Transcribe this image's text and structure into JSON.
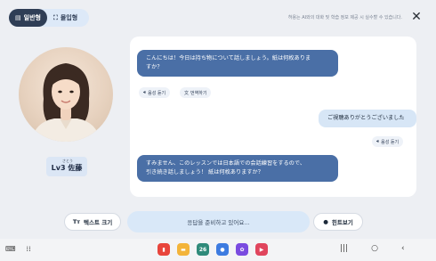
{
  "header": {
    "mode_tabs": [
      {
        "label": "일반형",
        "icon": "list-icon",
        "active": true
      },
      {
        "label": "몰입형",
        "icon": "fullscreen-icon",
        "active": false
      }
    ],
    "disclaimer": "허용는 AI와의 대화 및 학습 정보 제공 시 실수할 수 있습니다.",
    "close_icon": "close-icon"
  },
  "avatar": {
    "level_ruby": "さとう",
    "level_label": "Lv3 佐藤"
  },
  "chat": {
    "messages": [
      {
        "role": "ai",
        "lines": [
          "こんにちは！今日は持ち物について話しましょう。紙は何枚ありま",
          "すか？"
        ],
        "actions": [
          {
            "label": "음성 듣기",
            "icon": "speaker-icon"
          },
          {
            "label": "번역하기",
            "icon": "translate-icon"
          }
        ]
      },
      {
        "role": "user",
        "lines": [
          "ご視聴ありがとうございました"
        ],
        "actions": [
          {
            "label": "음성 듣기",
            "icon": "speaker-icon"
          }
        ]
      },
      {
        "role": "ai",
        "lines": [
          "すみません、このレッスンでは日本語での会話練習をするので、",
          "引き続き話しましょう！ 紙は何枚ありますか？"
        ],
        "actions": []
      }
    ]
  },
  "controls": {
    "text_size_label": "텍스트 크기",
    "text_size_icon": "text-size-icon",
    "status_text": "응답을 준비하고 있어요...",
    "hint_label": "힌트보기",
    "hint_icon": "lightbulb-icon"
  },
  "colors": {
    "ai_bubble": "#4a6fa6",
    "user_bubble": "#d7e6f6",
    "active_tab": "#2f3e56",
    "status_field": "#d9e8f8"
  },
  "navbar": {
    "dock_apps": [
      {
        "icon": "red-app-icon",
        "color": "#e8453c"
      },
      {
        "icon": "folder-icon",
        "color": "#f3b43a"
      },
      {
        "icon": "calendar-icon",
        "color": "#2f8a7a",
        "label": "26"
      },
      {
        "icon": "message-icon",
        "color": "#3d7be0"
      },
      {
        "icon": "gallery-icon",
        "color": "#7a4be0"
      },
      {
        "icon": "video-icon",
        "color": "#e0455d"
      }
    ]
  }
}
